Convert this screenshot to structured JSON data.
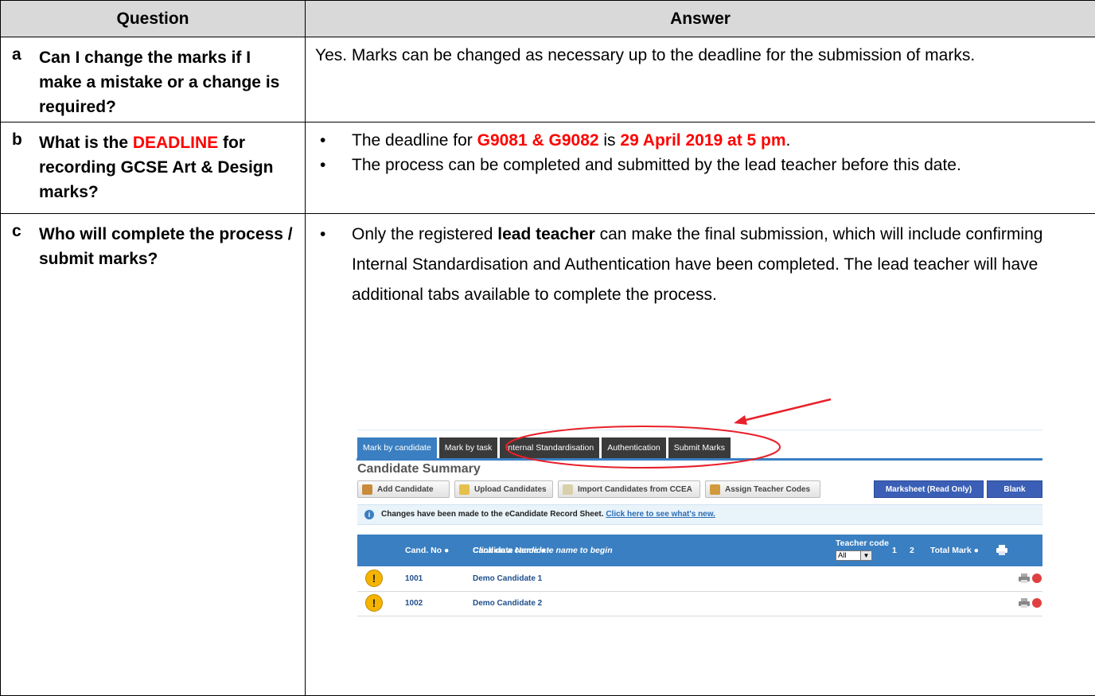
{
  "table": {
    "header_question": "Question",
    "header_answer": "Answer"
  },
  "rows": [
    {
      "letter": "a",
      "question": "Can I change the marks if I make a mistake or a change is required?",
      "answer": "Yes. Marks can be changed as necessary up to the deadline for the submission of marks."
    },
    {
      "letter": "b",
      "question_part1": "What is the ",
      "question_highlight": "DEADLINE",
      "question_part2": " for recording GCSE Art & Design marks?",
      "bullet1_part1": "The deadline for ",
      "bullet1_highlight1": "G9081 & G9082",
      "bullet1_part2": " is ",
      "bullet1_highlight2": "29 April 2019 at 5 pm",
      "bullet1_part3": ".",
      "bullet2": "The process can be completed and submitted by the lead teacher before this date."
    },
    {
      "letter": "c",
      "question": "Who will complete the process / submit marks?",
      "bullet_part1": "Only the registered ",
      "bullet_bold": "lead teacher",
      "bullet_part2": " can make the final submission, which will include confirming Internal Standardisation and Authentication have been completed.  The lead teacher will have additional tabs available to complete the process."
    }
  ],
  "screenshot": {
    "tabs": [
      "Mark by candidate",
      "Mark by task",
      "Internal Standardisation",
      "Authentication",
      "Submit Marks"
    ],
    "title": "Candidate Summary",
    "buttons": [
      "Add Candidate",
      "Upload Candidates",
      "Import Candidates from CCEA",
      "Assign Teacher Codes"
    ],
    "blue_buttons": [
      "Marksheet (Read Only)",
      "Blank eCRS"
    ],
    "notice_text": "Changes have been made to the eCandidate Record Sheet.",
    "notice_link": "Click here to see what's new.",
    "columns": {
      "cand_no": "Cand. No ●",
      "name": "Candidate Name ● - ",
      "name_hint": "Click on a candidate name to begin",
      "teacher_code": "Teacher code",
      "teacher_select": "All",
      "c1": "1",
      "c2": "2",
      "total": "Total Mark ●"
    },
    "candidates": [
      {
        "no": "1001",
        "name": "Demo Candidate 1"
      },
      {
        "no": "1002",
        "name": "Demo Candidate 2"
      }
    ],
    "accent_blue": "#3a7fc1",
    "annotation_color": "#e8202a"
  }
}
